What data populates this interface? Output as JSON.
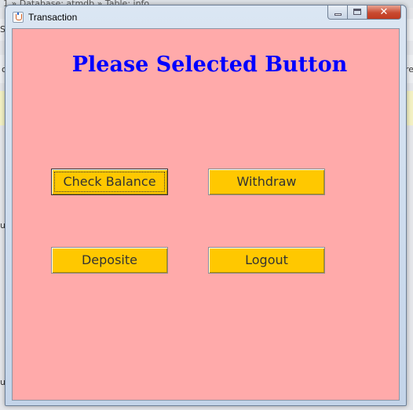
{
  "background_app": {
    "breadcrumb": "1 » Database: atmdb » Table: info",
    "edge_texts": [
      "Si",
      "o",
      "re",
      "un",
      "un"
    ]
  },
  "window": {
    "title": "Transaction",
    "close_glyph": "✕"
  },
  "content": {
    "heading": "Please Selected Button",
    "background_color": "#ffaaaa",
    "heading_color": "#0000ff",
    "button_color": "#ffc800",
    "buttons": {
      "check_balance": "Check Balance",
      "withdraw": "Withdraw",
      "deposite": "Deposite",
      "logout": "Logout"
    }
  }
}
